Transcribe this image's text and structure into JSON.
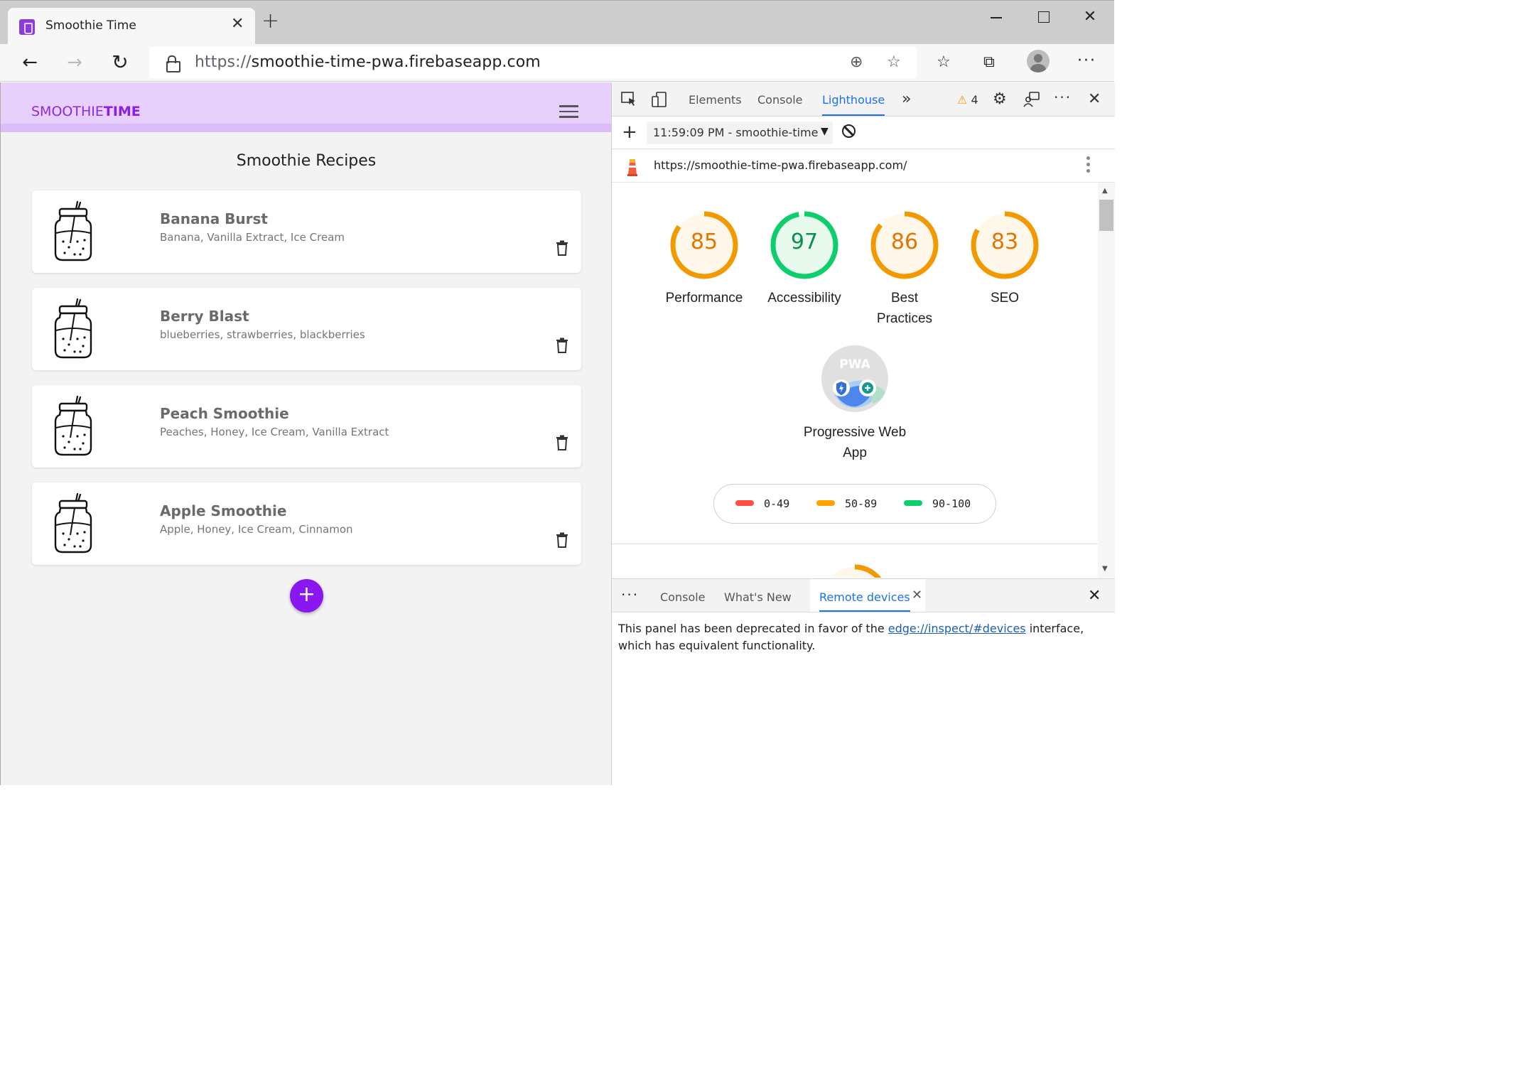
{
  "browser": {
    "tab_title": "Smoothie Time",
    "url_protocol": "https://",
    "url_host": "smoothie-time-pwa.firebaseapp.com"
  },
  "app": {
    "logo_prefix": "SMOOTHIE",
    "logo_suffix": "TIME",
    "page_title": "Smoothie Recipes",
    "add_label": "+",
    "recipes": [
      {
        "name": "Banana Burst",
        "ingredients": "Banana, Vanilla Extract, Ice Cream"
      },
      {
        "name": "Berry Blast",
        "ingredients": "blueberries, strawberries, blackberries"
      },
      {
        "name": "Peach Smoothie",
        "ingredients": "Peaches, Honey, Ice Cream, Vanilla Extract"
      },
      {
        "name": "Apple Smoothie",
        "ingredients": "Apple, Honey, Ice Cream, Cinnamon"
      }
    ]
  },
  "devtools": {
    "tabs": {
      "elements": "Elements",
      "console": "Console",
      "lighthouse": "Lighthouse"
    },
    "more_tabs": "»",
    "warning_count": "4",
    "report_select": "11:59:09 PM - smoothie-time-",
    "report_url": "https://smoothie-time-pwa.firebaseapp.com/",
    "scores": [
      {
        "value": "85",
        "label": "Performance",
        "fraction": 0.85,
        "color": "#f29900",
        "fill": "#fff7e9"
      },
      {
        "value": "97",
        "label": "Accessibility",
        "fraction": 0.97,
        "color": "#0cce6b",
        "fill": "#e8f9ee"
      },
      {
        "value": "86",
        "label": "Best Practices",
        "fraction": 0.86,
        "color": "#f29900",
        "fill": "#fff7e9"
      },
      {
        "value": "83",
        "label": "SEO",
        "fraction": 0.83,
        "color": "#f29900",
        "fill": "#fff7e9"
      }
    ],
    "pwa_badge_text": "PWA",
    "pwa_label": "Progressive Web App",
    "legend": [
      {
        "range": "0-49",
        "color": "#ff4e42"
      },
      {
        "range": "50-89",
        "color": "#ffa400"
      },
      {
        "range": "90-100",
        "color": "#0cce6b"
      }
    ],
    "drawer": {
      "console": "Console",
      "whats_new": "What's New",
      "remote_devices": "Remote devices",
      "message_before": "This panel has been deprecated in favor of the ",
      "message_link": "edge://inspect/#devices",
      "message_after": " interface, which has equivalent functionality."
    }
  },
  "colors": {
    "accent": "#8a17f0",
    "devtools_blue": "#1a73e8",
    "header_bg": "#e7d0fb"
  }
}
